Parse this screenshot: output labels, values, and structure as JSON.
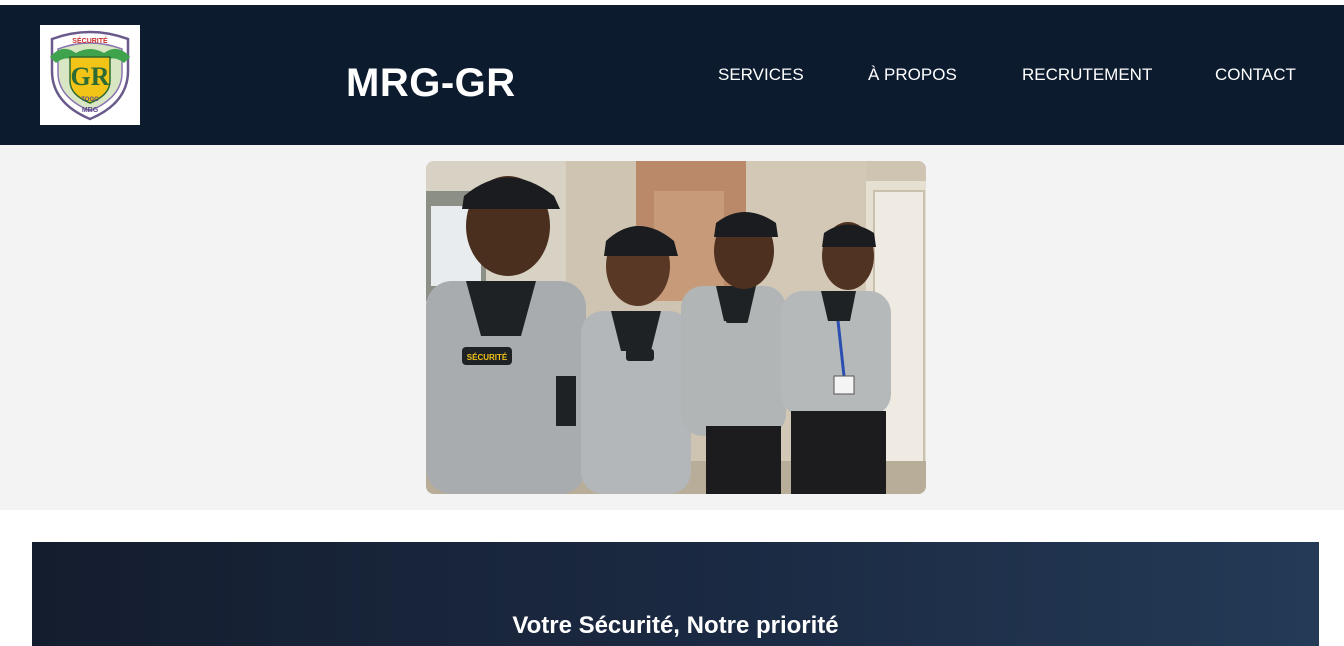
{
  "header": {
    "brand": "MRG-GR",
    "logo_icon": "security-shield-logo",
    "logo_text": {
      "top": "SÉCURITÉ",
      "initials": "GR",
      "country": "TOGO",
      "bottom": "MRG"
    },
    "background_color": "#0d1b2e"
  },
  "nav": {
    "items": [
      {
        "label": "SERVICES"
      },
      {
        "label": "À PROPOS"
      },
      {
        "label": "RECRUTEMENT"
      },
      {
        "label": "CONTACT"
      }
    ]
  },
  "hero": {
    "photo_icon": "security-team-photo",
    "badge_text": "SÉCURITÉ",
    "background_color": "#f3f3f4"
  },
  "banner": {
    "title": "Votre Sécurité, Notre priorité"
  }
}
